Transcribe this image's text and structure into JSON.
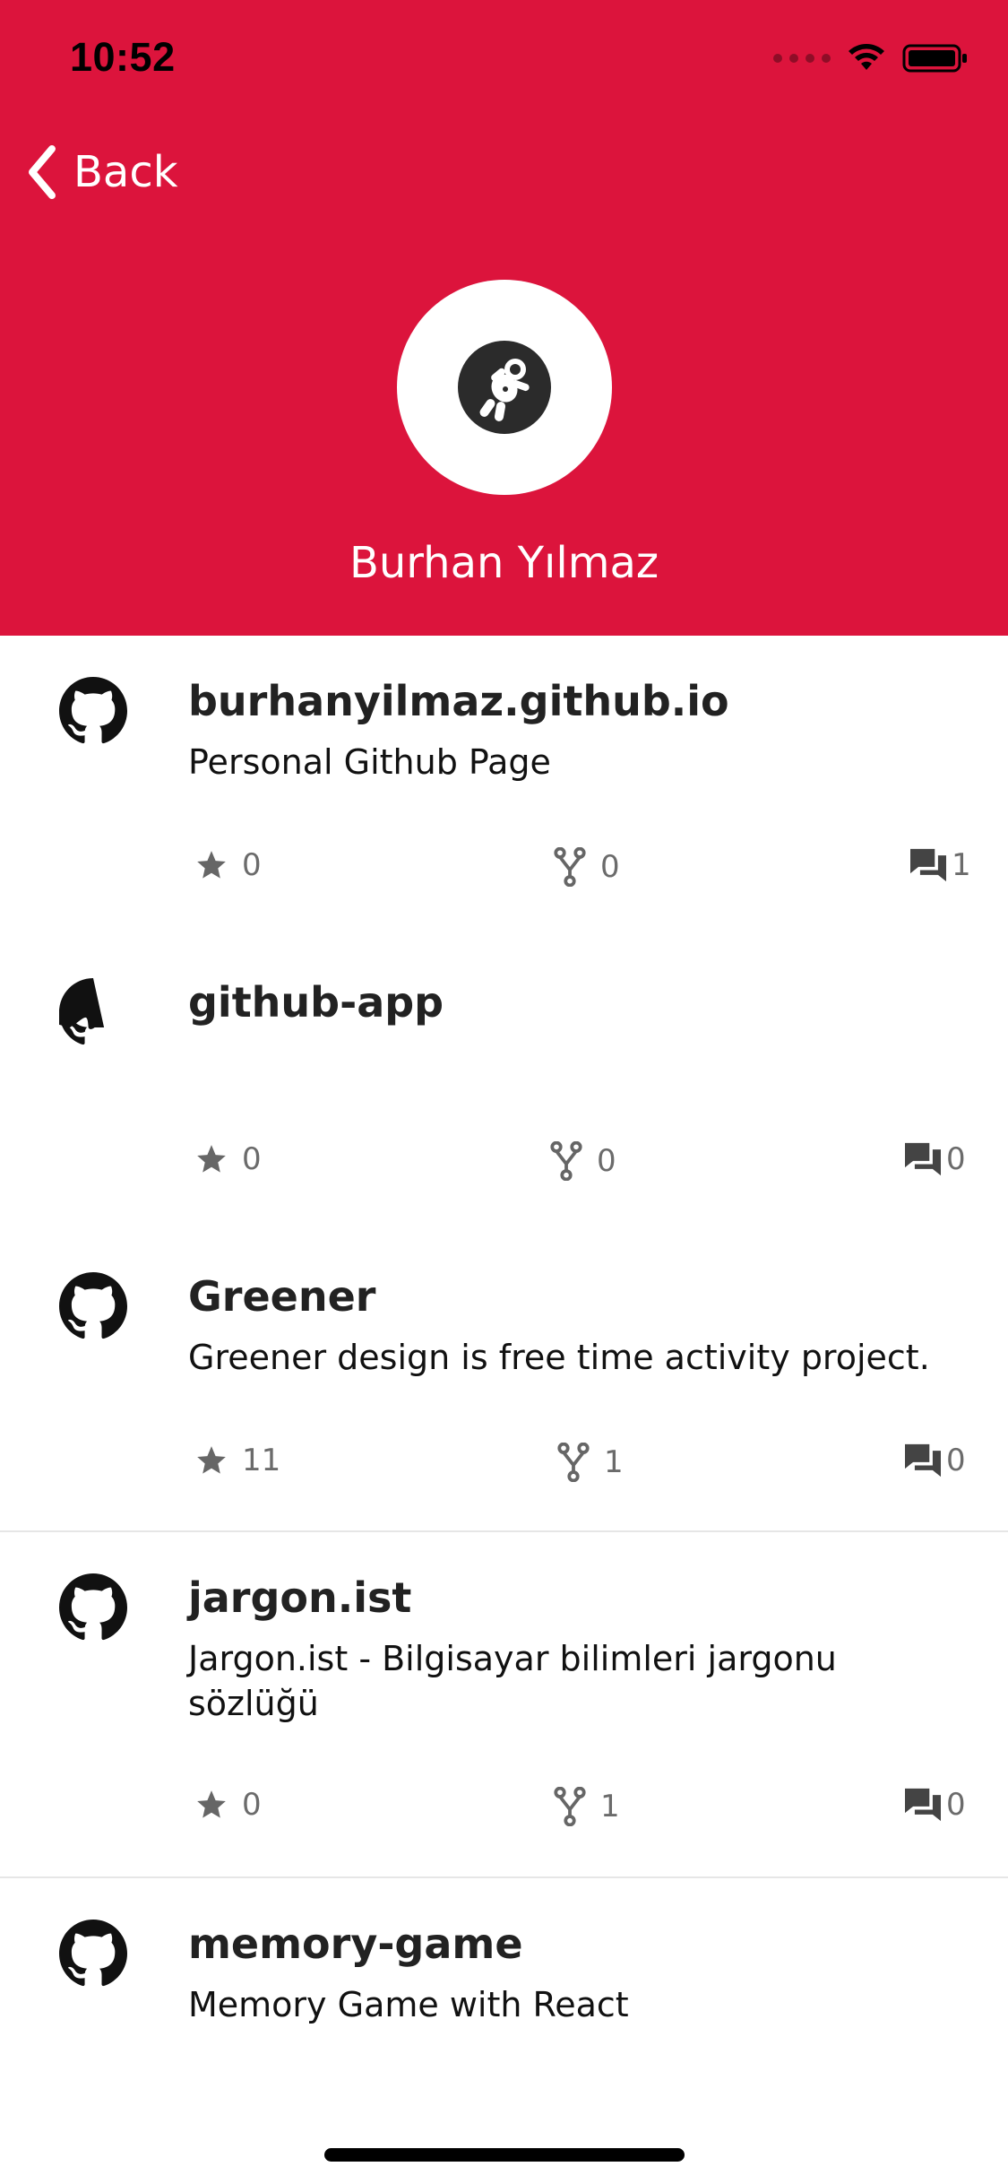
{
  "status_bar": {
    "time": "10:52",
    "icons": [
      "signal-dots-icon",
      "wifi-icon",
      "battery-icon"
    ]
  },
  "nav": {
    "back_label": "Back",
    "back_icon": "chevron-left-icon"
  },
  "profile": {
    "name": "Burhan Yılmaz",
    "avatar_icon": "astronaut-icon"
  },
  "colors": {
    "header_bg": "#DC143C",
    "text_primary": "#222222",
    "stat_gray": "#6b6b6b"
  },
  "repos": [
    {
      "name": "burhanyilmaz.github.io",
      "description": "Personal Github Page",
      "stars": "0",
      "forks": "0",
      "comments": "1"
    },
    {
      "name": "github-app",
      "description": "",
      "stars": "0",
      "forks": "0",
      "comments": "0"
    },
    {
      "name": "Greener",
      "description": "Greener design is free time activity project.",
      "stars": "11",
      "forks": "1",
      "comments": "0"
    },
    {
      "name": "jargon.ist",
      "description": "Jargon.ist - Bilgisayar bilimleri jargonu sözlüğü",
      "stars": "0",
      "forks": "1",
      "comments": "0"
    },
    {
      "name": "memory-game",
      "description": "Memory Game with React",
      "stars": "",
      "forks": "",
      "comments": ""
    }
  ]
}
